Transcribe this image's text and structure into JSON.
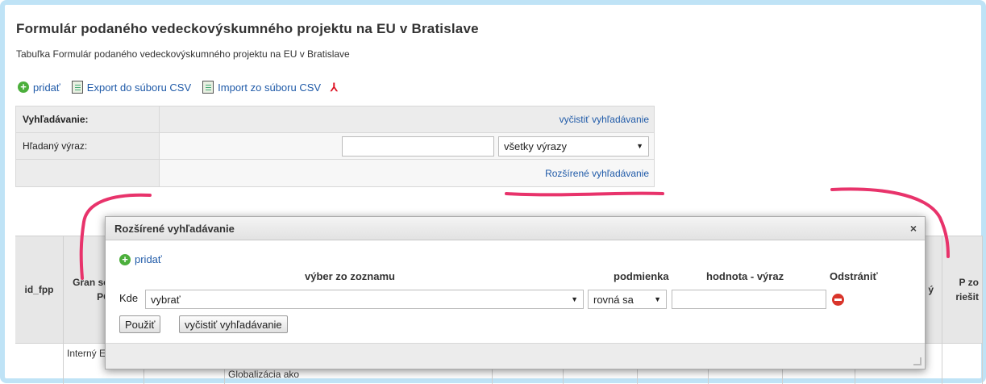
{
  "page": {
    "title": "Formulár podaného vedeckovýskumného projektu na EU v Bratislave",
    "subtitle": "Tabuľka Formulár podaného vedeckovýskumného projektu na EU v Bratislave"
  },
  "toolbar": {
    "add_label": "pridať",
    "export_label": "Export do súboru CSV",
    "import_label": "Import zo súboru CSV"
  },
  "search": {
    "header_label": "Vyhľadávanie:",
    "clear_link": "vyčistiť vyhľadávanie",
    "term_label": "Hľadaný výraz:",
    "term_value": "",
    "scope_value": "všetky výrazy",
    "advanced_link": "Rozšírené vyhľadávanie"
  },
  "table": {
    "headers": [
      "id_fpp",
      "Gran sch (POV POL",
      "",
      "",
      "",
      "",
      "",
      "",
      "",
      "ý",
      "P zo riešit"
    ],
    "row0": [
      "",
      "Interný EU v",
      "EU v",
      "Globalizácia ako"
    ]
  },
  "dialog": {
    "title": "Rozšírené vyhľadávanie",
    "add_label": "pridať",
    "col_field": "výber zo zoznamu",
    "col_condition": "podmienka",
    "col_value": "hodnota - výraz",
    "col_remove": "Odstrániť",
    "where_label": "Kde",
    "field_value": "vybrať",
    "condition_value": "rovná sa",
    "value_value": "",
    "apply_button": "Použiť",
    "clear_button": "vyčistiť vyhľadávanie"
  },
  "colors": {
    "link": "#1f5aa8",
    "annotation": "#e8336b",
    "frame": "#bfe3f6"
  }
}
